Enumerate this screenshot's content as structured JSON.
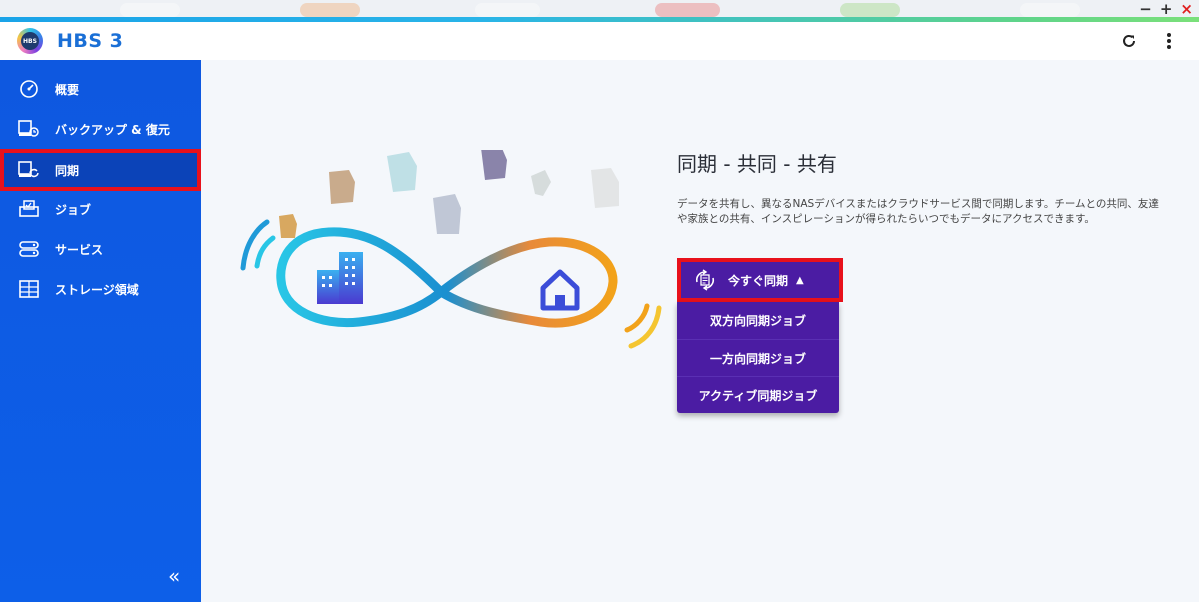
{
  "window": {
    "controls": [
      "−",
      "+",
      "×"
    ]
  },
  "header": {
    "title": "HBS 3",
    "logo_text": "HBS"
  },
  "sidebar": {
    "items": [
      {
        "label": "概要",
        "icon": "gauge-icon"
      },
      {
        "label": "バックアップ & 復元",
        "icon": "backup-restore-icon"
      },
      {
        "label": "同期",
        "icon": "sync-icon"
      },
      {
        "label": "ジョブ",
        "icon": "jobs-icon"
      },
      {
        "label": "サービス",
        "icon": "services-icon"
      },
      {
        "label": "ストレージ領域",
        "icon": "storage-icon"
      }
    ],
    "active_index": 2,
    "collapse_label": "«"
  },
  "main": {
    "heading": "同期 - 共同 - 共有",
    "description": "データを共有し、異なるNASデバイスまたはクラウドサービス間で同期します。チームとの共同、友達や家族との共有、インスピレーションが得られたらいつでもデータにアクセスできます。",
    "sync_button": {
      "label": "今すぐ同期",
      "caret": "▲"
    },
    "menu": [
      {
        "label": "双方向同期ジョブ"
      },
      {
        "label": "一方向同期ジョブ"
      },
      {
        "label": "アクティブ同期ジョブ"
      }
    ]
  },
  "colors": {
    "sidebar": "#0e58e0",
    "accent_purple": "#4b1ca3",
    "highlight_red": "#e8111b",
    "title_blue": "#1a6fd6"
  }
}
